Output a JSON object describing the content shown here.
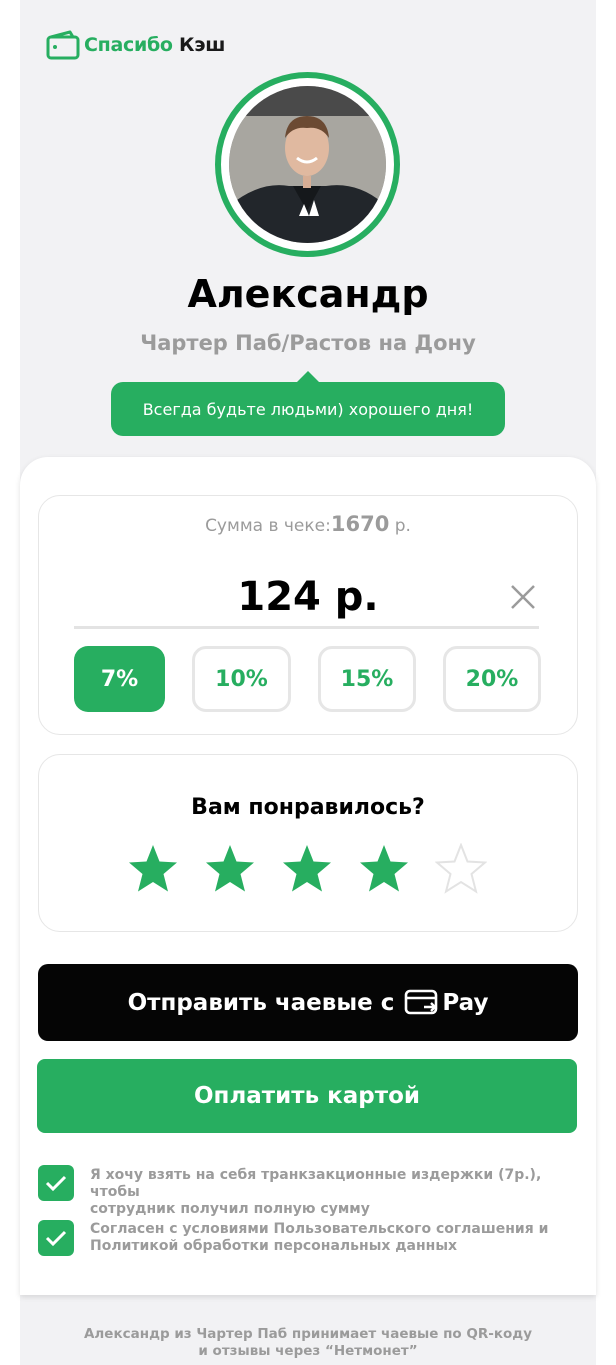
{
  "brand": {
    "name_part1": "Спасибо",
    "name_part2": "Кэш",
    "accent_color": "#27ae60"
  },
  "profile": {
    "name": "Александр",
    "place": "Чартер Паб/Растов на Дону",
    "message": "Всегда будьте людьми) хорошего дня!"
  },
  "bill": {
    "label": "Сумма в чеке:",
    "amount": "1670",
    "currency": "р."
  },
  "tip": {
    "amount": "124 р.",
    "options": [
      {
        "label": "7%",
        "selected": true
      },
      {
        "label": "10%",
        "selected": false
      },
      {
        "label": "15%",
        "selected": false
      },
      {
        "label": "20%",
        "selected": false
      }
    ]
  },
  "rating": {
    "question": "Вам понравилось?",
    "value": 4,
    "max": 5
  },
  "buttons": {
    "pay_prefix": "Отправить чаевые с",
    "pay_brand": "Pay",
    "card": "Оплатить картой"
  },
  "checkboxes": [
    {
      "line1": "Я хочу взять на себя транкзакционные издержки (7р.), чтобы",
      "line2": "сотрудник получил полную сумму",
      "checked": true
    },
    {
      "line1": "Согласен с условиями Пользовательского соглашения и",
      "line2": "Политикой обработки персональных данных",
      "checked": true
    }
  ],
  "footer": {
    "line1": "Александр из Чартер Паб принимает чаевые по QR-коду",
    "line2": "и отзывы через “Нетмонет”"
  }
}
